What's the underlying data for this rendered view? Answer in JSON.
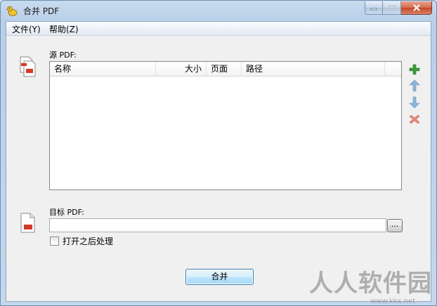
{
  "window": {
    "title": "合并 PDF"
  },
  "menu": [
    {
      "label": "文件(Y)"
    },
    {
      "label": "帮助(Z)"
    }
  ],
  "source": {
    "label": "源 PDF:",
    "columns": [
      "名称",
      "大小",
      "页面",
      "路径"
    ],
    "rows": []
  },
  "side_buttons": [
    {
      "icon": "plus-icon",
      "color": "#3a9a3a"
    },
    {
      "icon": "arrow-up-icon",
      "color": "#7fa9cf"
    },
    {
      "icon": "arrow-down-icon",
      "color": "#7fa9cf"
    },
    {
      "icon": "delete-x-icon",
      "color": "#e07a6a"
    }
  ],
  "target": {
    "label": "目标 PDF:",
    "value": "",
    "browse_label": "..."
  },
  "open_after": {
    "label": "打开之后处理",
    "checked": false
  },
  "merge_button": {
    "label": "合并"
  },
  "watermark": {
    "text": "人人软件园",
    "url": "www.kkx.net"
  }
}
